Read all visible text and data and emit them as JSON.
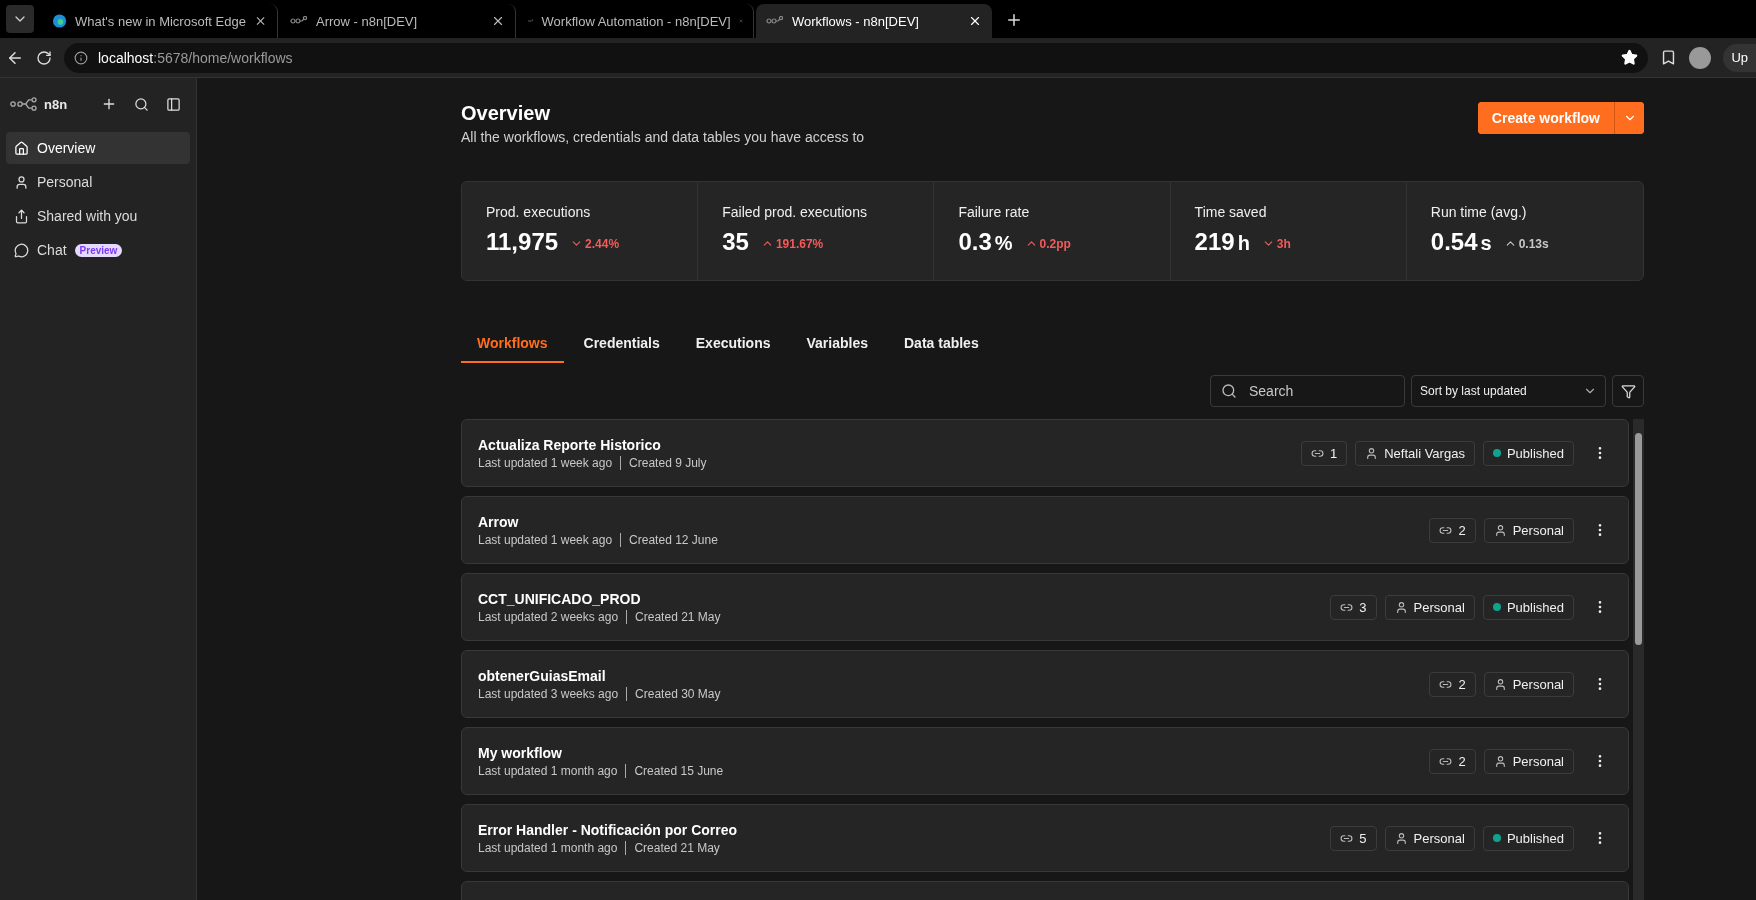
{
  "browser": {
    "tabs": [
      {
        "title": "What's new in Microsoft Edge",
        "kind": "edge",
        "selected": false
      },
      {
        "title": "Arrow - n8n[DEV]",
        "kind": "n8n",
        "selected": false
      },
      {
        "title": "Workflow Automation - n8n[DEV]",
        "kind": "n8n",
        "selected": false
      },
      {
        "title": "Workflows - n8n[DEV]",
        "kind": "n8n",
        "selected": true
      }
    ],
    "address_host": "localhost",
    "address_path": ":5678/home/workflows",
    "update_label": "Up"
  },
  "sidebar": {
    "brand": "n8n",
    "items": [
      {
        "label": "Overview",
        "selected": true
      },
      {
        "label": "Personal",
        "selected": false
      },
      {
        "label": "Shared with you",
        "selected": false
      },
      {
        "label": "Chat",
        "selected": false,
        "badge": "Preview"
      }
    ]
  },
  "header": {
    "title": "Overview",
    "subtitle": "All the workflows, credentials and data tables you have access to",
    "create_button": "Create workflow"
  },
  "stats": [
    {
      "label": "Prod. executions",
      "value": "11,975",
      "change": "2.44%",
      "rising": false,
      "alert": true
    },
    {
      "label": "Failed prod. executions",
      "value": "35",
      "change": "191.67%",
      "rising": true,
      "alert": true
    },
    {
      "label": "Failure rate",
      "value": "0.3",
      "unit": "%",
      "change": "0.2pp",
      "rising": true,
      "alert": true
    },
    {
      "label": "Time saved",
      "value": "219",
      "unit": "h",
      "change": "3h",
      "rising": false,
      "alert": true
    },
    {
      "label": "Run time (avg.)",
      "value": "0.54",
      "unit": "s",
      "change": "0.13s",
      "rising": true,
      "alert": false
    }
  ],
  "tabs": [
    {
      "label": "Workflows",
      "selected": true
    },
    {
      "label": "Credentials",
      "selected": false
    },
    {
      "label": "Executions",
      "selected": false
    },
    {
      "label": "Variables",
      "selected": false
    },
    {
      "label": "Data tables",
      "selected": false
    }
  ],
  "search": {
    "placeholder": "Search"
  },
  "sort": {
    "value": "Sort by last updated"
  },
  "workflows": [
    {
      "name": "Actualiza Reporte Historico",
      "updated": "Last updated 1 week ago",
      "created": "Created 9 July",
      "links": "1",
      "owner": "Neftali Vargas",
      "published": true,
      "published_label": "Published"
    },
    {
      "name": "Arrow",
      "updated": "Last updated 1 week ago",
      "created": "Created 12 June",
      "links": "2",
      "owner": "Personal",
      "published": false
    },
    {
      "name": "CCT_UNIFICADO_PROD",
      "updated": "Last updated 2 weeks ago",
      "created": "Created 21 May",
      "links": "3",
      "owner": "Personal",
      "published": true,
      "published_label": "Published"
    },
    {
      "name": "obtenerGuiasEmail",
      "updated": "Last updated 3 weeks ago",
      "created": "Created 30 May",
      "links": "2",
      "owner": "Personal",
      "published": false
    },
    {
      "name": "My workflow",
      "updated": "Last updated 1 month ago",
      "created": "Created 15 June",
      "links": "2",
      "owner": "Personal",
      "published": false
    },
    {
      "name": "Error Handler - Notificación por Correo",
      "updated": "Last updated 1 month ago",
      "created": "Created 21 May",
      "links": "5",
      "owner": "Personal",
      "published": true,
      "published_label": "Published"
    }
  ]
}
